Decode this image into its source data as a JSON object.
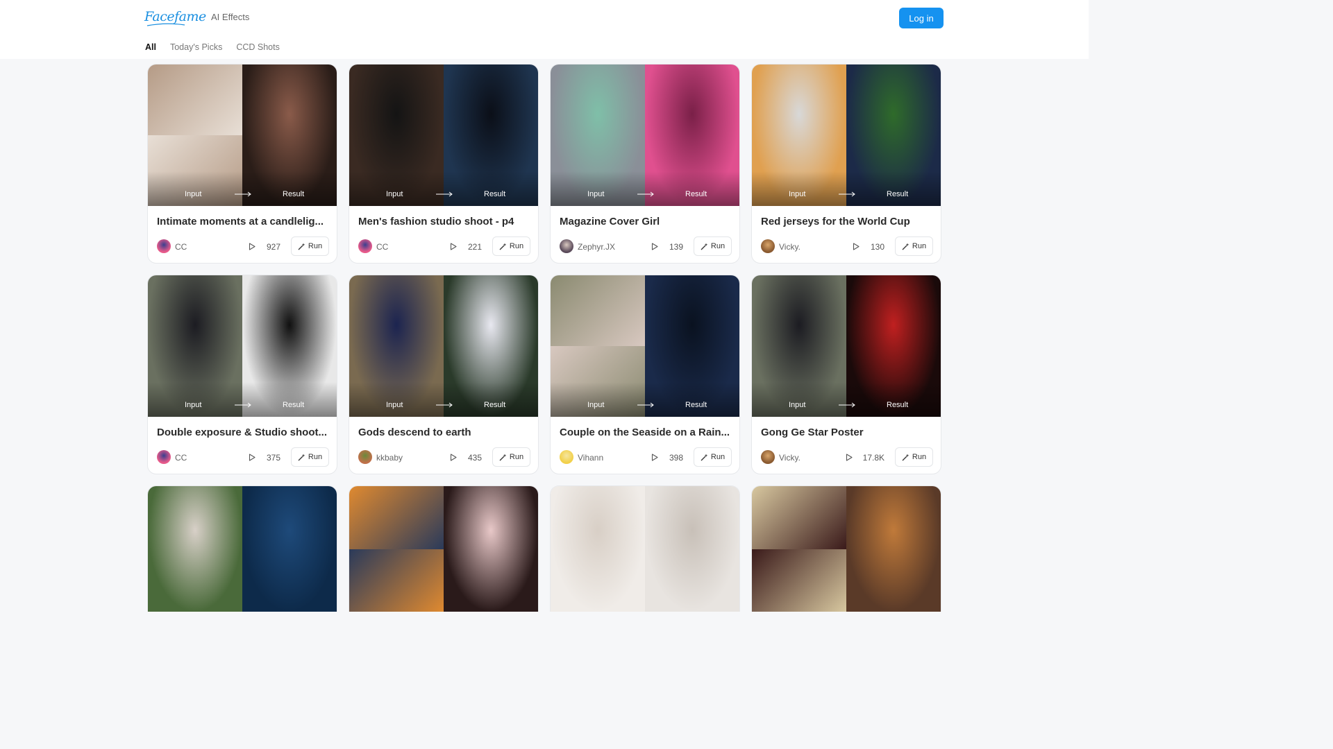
{
  "header": {
    "logo_text": "Facefame",
    "nav_link": "AI Effects",
    "login_label": "Log in",
    "brand_color": "#1592f0"
  },
  "tabs": [
    "All",
    "Today's Picks",
    "CCD Shots"
  ],
  "labels": {
    "input": "Input",
    "result": "Result",
    "run": "Run"
  },
  "cards": [
    {
      "title": "Intimate moments at a candlelig...",
      "author": "CC",
      "plays": "927",
      "avatar": [
        "#e85a8a",
        "#3a3f8f"
      ],
      "input": [
        "#b59b86",
        "#e8dfd6"
      ],
      "result": [
        "#2a1d18",
        "#8a5b4a"
      ],
      "split_input": true
    },
    {
      "title": "Men's fashion studio shoot - p4",
      "author": "CC",
      "plays": "221",
      "avatar": [
        "#e85a8a",
        "#3a3f8f"
      ],
      "input": [
        "#3a2a22",
        "#141414"
      ],
      "result": [
        "#1f3550",
        "#0b0f18"
      ],
      "split_input": false
    },
    {
      "title": "Magazine Cover Girl",
      "author": "Zephyr.JX",
      "plays": "139",
      "avatar": [
        "#5a4a5a",
        "#d9c8c0"
      ],
      "input": [
        "#8a8f98",
        "#7fbfa8"
      ],
      "result": [
        "#e0508f",
        "#7a2048"
      ],
      "split_input": false
    },
    {
      "title": "Red jerseys for the World Cup",
      "author": "Vicky.",
      "plays": "130",
      "avatar": [
        "#8a5a30",
        "#d9a56a"
      ],
      "input": [
        "#e0a050",
        "#d8d8d8"
      ],
      "result": [
        "#1c2a48",
        "#2f6b2a"
      ],
      "split_input": false
    },
    {
      "title": "Double exposure & Studio shoot...",
      "author": "CC",
      "plays": "375",
      "avatar": [
        "#e85a8a",
        "#3a3f8f"
      ],
      "input": [
        "#6a7060",
        "#1c1c22"
      ],
      "result": [
        "#e8e8e8",
        "#101010"
      ],
      "split_input": false
    },
    {
      "title": "Gods descend to earth",
      "author": "kkbaby",
      "plays": "435",
      "avatar": [
        "#c0704a",
        "#6a8a3a"
      ],
      "input": [
        "#7a6a50",
        "#1c2450"
      ],
      "result": [
        "#2a3a2a",
        "#e8e8f0"
      ],
      "split_input": false
    },
    {
      "title": "Couple on the Seaside on a Rain...",
      "author": "Vihann",
      "plays": "398",
      "avatar": [
        "#f2d04a",
        "#f5e6a0"
      ],
      "input": [
        "#8a8a70",
        "#d8c8c0"
      ],
      "result": [
        "#1a2a4a",
        "#0a1220"
      ],
      "split_input": true
    },
    {
      "title": "Gong Ge Star Poster",
      "author": "Vicky.",
      "plays": "17.8K",
      "avatar": [
        "#8a5a30",
        "#d9a56a"
      ],
      "input": [
        "#6a7060",
        "#1c1c22"
      ],
      "result": [
        "#1a0a0a",
        "#c02020"
      ],
      "split_input": false
    },
    {
      "title": "",
      "author": "",
      "plays": "",
      "avatar": [
        "#ffffff",
        "#ffffff"
      ],
      "input": [
        "#4a6a3a",
        "#d8d0c8"
      ],
      "result": [
        "#0d2a4a",
        "#1e4a7a"
      ],
      "split_input": false,
      "partial": true
    },
    {
      "title": "",
      "author": "",
      "plays": "",
      "avatar": [
        "#ffffff",
        "#ffffff"
      ],
      "input": [
        "#e08a30",
        "#2a3a5a"
      ],
      "result": [
        "#2a1a1a",
        "#e8c8c8"
      ],
      "split_input": true,
      "partial": true
    },
    {
      "title": "",
      "author": "",
      "plays": "",
      "avatar": [
        "#ffffff",
        "#ffffff"
      ],
      "input": [
        "#f0ece8",
        "#d8cfc6"
      ],
      "result": [
        "#e8e4e0",
        "#c8c0b8"
      ],
      "split_input": false,
      "partial": true
    },
    {
      "title": "",
      "author": "",
      "plays": "",
      "avatar": [
        "#ffffff",
        "#ffffff"
      ],
      "input": [
        "#d8c8a0",
        "#3a1a1a"
      ],
      "result": [
        "#5a3a28",
        "#c07a3a"
      ],
      "split_input": true,
      "partial": true
    }
  ]
}
